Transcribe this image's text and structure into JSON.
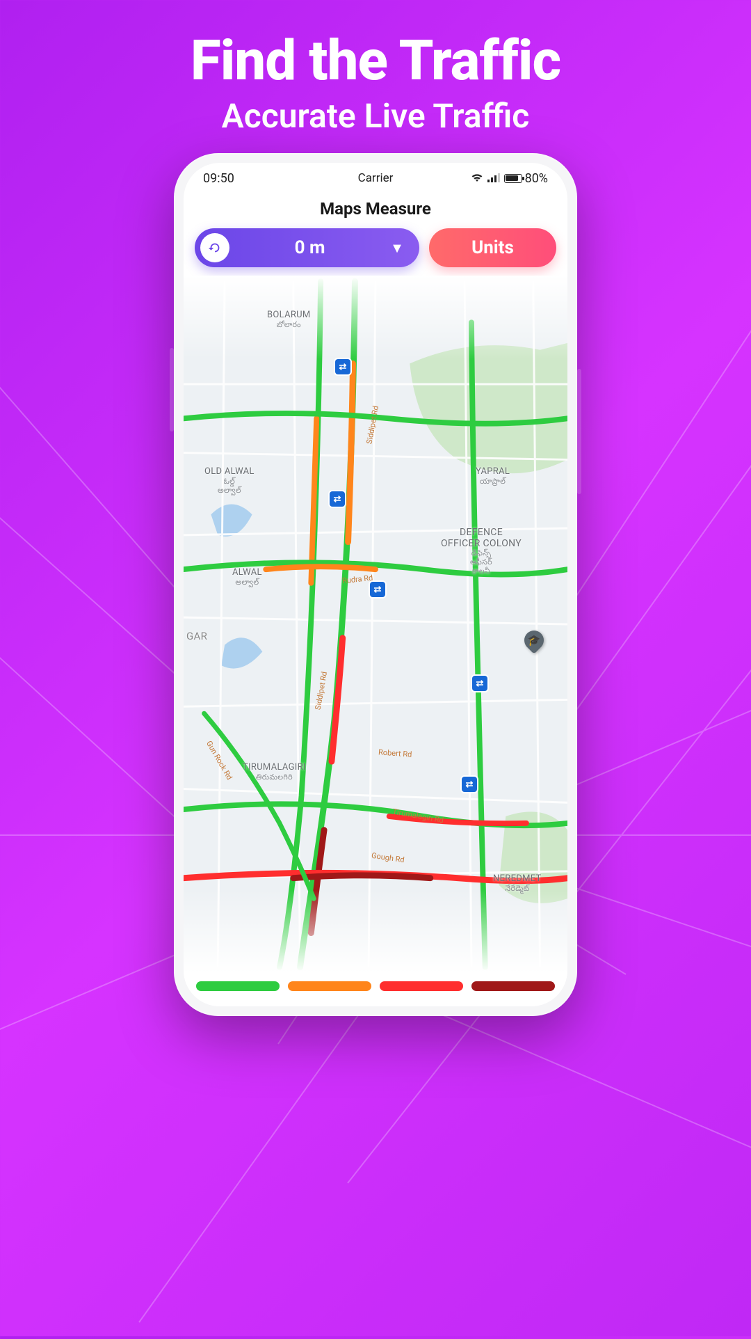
{
  "hero": {
    "title": "Find the Traffic",
    "subtitle": "Accurate Live Traffic"
  },
  "statusbar": {
    "time": "09:50",
    "carrier": "Carrier",
    "battery_pct": "80%"
  },
  "app": {
    "title": "Maps Measure"
  },
  "controls": {
    "distance": "0 m",
    "units_label": "Units"
  },
  "map_labels": {
    "bolarum": "BOLARUM",
    "bolarum_sub": "బోలారం",
    "old_alwal": "OLD ALWAL",
    "old_alwal_sub": "ఓల్డ్\nఅల్వాల్",
    "alwal": "ALWAL",
    "alwal_sub": "అల్వాల్",
    "gar": "GAR",
    "yapral": "YAPRAL",
    "yapral_sub": "యాప్రాల్",
    "defence": "DEFENCE\nOFFICER COLONY",
    "defence_sub": "డిఫెన్స్\nఆఫీసర్\nకాలనీ",
    "tirumalagiri": "TIRUMALAGIRI",
    "tirumalagiri_sub": "తిరుమలగిరి",
    "neredmet": "NEREDMET",
    "neredmet_sub": "నేరేడ్మెట్"
  },
  "roads": {
    "siddipet": "Siddipet Rd",
    "rudra": "Rudra Rd",
    "gunrock": "Gun Rock Rd",
    "robert": "Robert Rd",
    "gough": "Gough Rd",
    "tirumalagiri_rd": "Tirumalagiri Rd"
  },
  "legend": {
    "free": "#2ecc40",
    "slow": "#ff851b",
    "heavy": "#ff2e2e",
    "standstill": "#a01818"
  }
}
